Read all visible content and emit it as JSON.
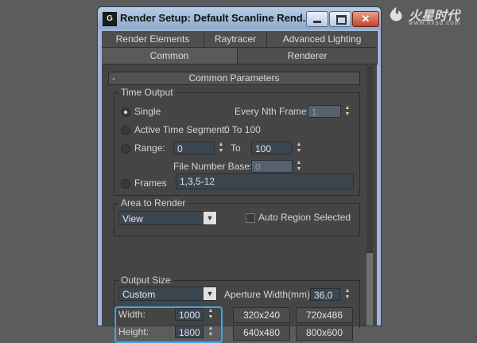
{
  "window": {
    "title": "Render Setup: Default Scanline Rend...",
    "icon_text": "G",
    "close_glyph": "✕"
  },
  "watermark": {
    "cn": "火星时代",
    "url": "www.hxsd.com"
  },
  "tabs": {
    "row1": [
      "Render Elements",
      "Raytracer",
      "Advanced Lighting"
    ],
    "row2": [
      "Common",
      "Renderer"
    ],
    "active": "Common"
  },
  "rollout": {
    "collapse_glyph": "-",
    "title": "Common Parameters"
  },
  "time_output": {
    "title": "Time Output",
    "single": "Single",
    "every_nth_label": "Every Nth Frame:",
    "every_nth_value": "1",
    "active_segment_label": "Active Time Segment:",
    "active_segment_value": "0 To 100",
    "range_label": "Range:",
    "range_from": "0",
    "range_to_label": "To",
    "range_to": "100",
    "file_base_label": "File Number Base:",
    "file_base_value": "0",
    "frames_label": "Frames",
    "frames_value": "1,3,5-12",
    "selected": "Single"
  },
  "area_to_render": {
    "title": "Area to Render",
    "value": "View",
    "auto_region_label": "Auto Region Selected",
    "auto_region_checked": false
  },
  "output_size": {
    "title": "Output Size",
    "preset": "Custom",
    "aperture_label": "Aperture Width(mm):",
    "aperture_value": "36,0",
    "width_label": "Width:",
    "width_value": "1000",
    "height_label": "Height:",
    "height_value": "1800",
    "presets": [
      "320x240",
      "720x486",
      "640x480",
      "800x600"
    ]
  },
  "colors": {
    "highlight": "#3fa6e6",
    "panel": "#454545",
    "titlebar": "#9fb8d6"
  }
}
